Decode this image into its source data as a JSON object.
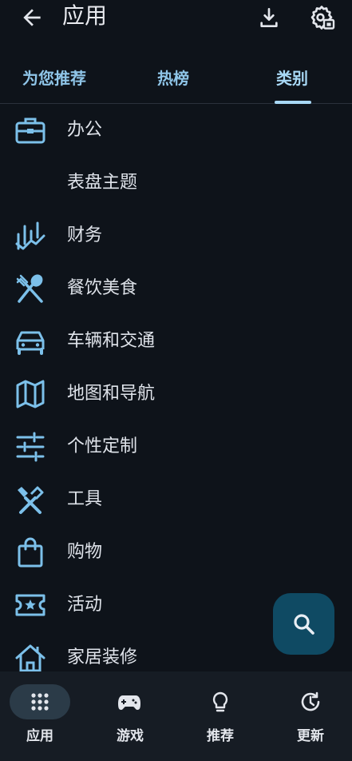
{
  "header": {
    "title": "应用"
  },
  "tabs": [
    {
      "label": "为您推荐"
    },
    {
      "label": "热榜"
    },
    {
      "label": "类别"
    }
  ],
  "categories": [
    {
      "label": "办公",
      "icon": "briefcase-icon"
    },
    {
      "label": "表盘主题",
      "icon": ""
    },
    {
      "label": "财务",
      "icon": "finance-chart-icon"
    },
    {
      "label": "餐饮美食",
      "icon": "food-utensils-icon"
    },
    {
      "label": "车辆和交通",
      "icon": "car-icon"
    },
    {
      "label": "地图和导航",
      "icon": "map-icon"
    },
    {
      "label": "个性定制",
      "icon": "sliders-icon"
    },
    {
      "label": "工具",
      "icon": "tools-icon"
    },
    {
      "label": "购物",
      "icon": "shopping-bag-icon"
    },
    {
      "label": "活动",
      "icon": "ticket-icon"
    },
    {
      "label": "家居装修",
      "icon": "home-icon"
    }
  ],
  "bottom_nav": [
    {
      "label": "应用",
      "icon": "apps-grid-icon",
      "active": true
    },
    {
      "label": "游戏",
      "icon": "gamepad-icon",
      "active": false
    },
    {
      "label": "推荐",
      "icon": "lightbulb-icon",
      "active": false
    },
    {
      "label": "更新",
      "icon": "update-icon",
      "active": false
    }
  ],
  "colors": {
    "background": "#0e131a",
    "accent": "#8fc5e8",
    "icon": "#7cc0ea",
    "fab": "#0f4a63",
    "nav_bar": "#161c24"
  }
}
